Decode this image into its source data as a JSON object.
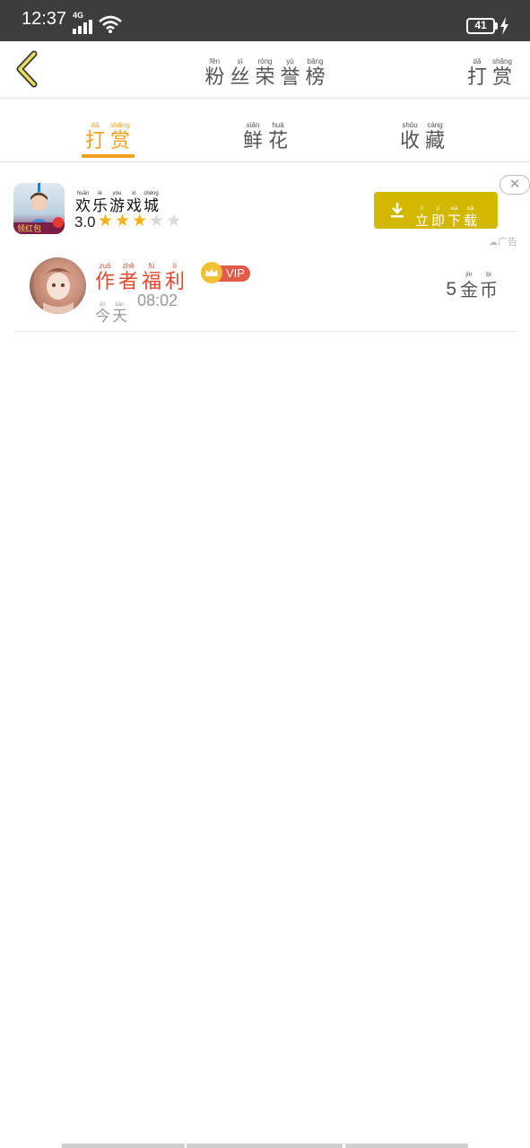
{
  "status_bar": {
    "time": "12:37",
    "network": "4G",
    "battery": "41"
  },
  "header": {
    "title": [
      {
        "py": "fěn",
        "hz": "粉"
      },
      {
        "py": "sī",
        "hz": "丝"
      },
      {
        "py": "róng",
        "hz": "荣"
      },
      {
        "py": "yù",
        "hz": "誉"
      },
      {
        "py": "bǎng",
        "hz": "榜"
      }
    ],
    "reward": [
      {
        "py": "dǎ",
        "hz": "打"
      },
      {
        "py": "shǎng",
        "hz": "赏"
      }
    ]
  },
  "tabs": [
    {
      "active": true,
      "chars": [
        {
          "py": "dǎ",
          "hz": "打"
        },
        {
          "py": "shǎng",
          "hz": "赏"
        }
      ]
    },
    {
      "active": false,
      "chars": [
        {
          "py": "xiān",
          "hz": "鲜"
        },
        {
          "py": "huā",
          "hz": "花"
        }
      ]
    },
    {
      "active": false,
      "chars": [
        {
          "py": "shōu",
          "hz": "收"
        },
        {
          "py": "cáng",
          "hz": "藏"
        }
      ]
    }
  ],
  "ad": {
    "title": [
      {
        "py": "huān",
        "hz": "欢"
      },
      {
        "py": "lè",
        "hz": "乐"
      },
      {
        "py": "yóu",
        "hz": "游"
      },
      {
        "py": "xì",
        "hz": "戏"
      },
      {
        "py": "chéng",
        "hz": "城"
      }
    ],
    "rating": "3.0",
    "rating_stars": 3,
    "rating_max": 5,
    "icon_caption": "领红包",
    "download": [
      {
        "py": "lì",
        "hz": "立"
      },
      {
        "py": "jí",
        "hz": "即"
      },
      {
        "py": "xià",
        "hz": "下"
      },
      {
        "py": "zài",
        "hz": "载"
      }
    ],
    "close_symbol": "✕",
    "label": "广告",
    "accent": "#d3b800"
  },
  "rewards": [
    {
      "name": [
        {
          "py": "zuò",
          "hz": "作"
        },
        {
          "py": "zhě",
          "hz": "者"
        },
        {
          "py": "fú",
          "hz": "福"
        },
        {
          "py": "lì",
          "hz": "利"
        }
      ],
      "badge": "VIP",
      "day": [
        {
          "py": "jīn",
          "hz": "今"
        },
        {
          "py": "tiān",
          "hz": "天"
        }
      ],
      "time": "08:02",
      "amount": "5",
      "unit": [
        {
          "py": "jīn",
          "hz": "金"
        },
        {
          "py": "bì",
          "hz": "币"
        }
      ]
    }
  ],
  "colors": {
    "accent": "#f0a21e",
    "name_red": "#e5482c",
    "vip_red": "#e25a4a",
    "star": "#f2b318"
  }
}
